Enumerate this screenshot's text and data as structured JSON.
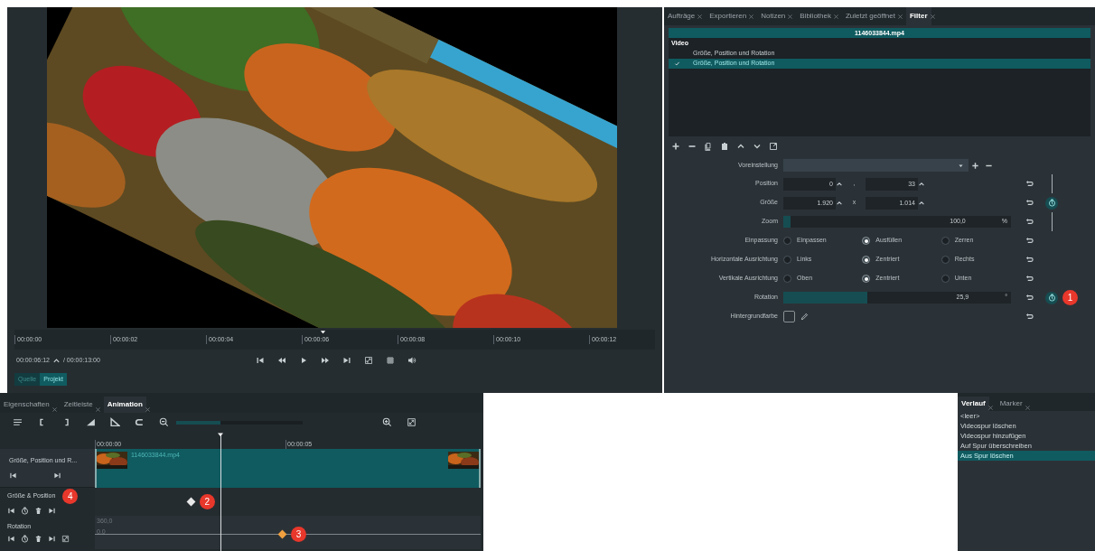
{
  "player": {
    "ruler": [
      "00:00:00",
      "00:00:02",
      "00:00:04",
      "00:00:06",
      "00:00:08",
      "00:00:10",
      "00:00:12"
    ],
    "playhead": {
      "level": 0.475
    },
    "timecode": "00:00:06:12",
    "duration": "/ 00:00:13:00",
    "tabs": [
      {
        "label": "Quelle",
        "selected": false
      },
      {
        "label": "Projekt",
        "selected": true
      }
    ]
  },
  "filter_panel": {
    "tabs": [
      {
        "label": "Aufträge",
        "selected": false
      },
      {
        "label": "Exportieren",
        "selected": false
      },
      {
        "label": "Notizen",
        "selected": false
      },
      {
        "label": "Bibliothek",
        "selected": false
      },
      {
        "label": "Zuletzt geöffnet",
        "selected": false
      },
      {
        "label": "Filter",
        "selected": true
      }
    ],
    "clip": "1146033844.mp4",
    "group": "Video",
    "filters": [
      {
        "label": "Größe, Position und Rotation",
        "checked": false,
        "selected": false
      },
      {
        "label": "Größe, Position und Rotation",
        "checked": true,
        "selected": true
      }
    ],
    "preset": {
      "label": "Voreinstellung"
    },
    "params": [
      {
        "kind": "pair",
        "label": "Position",
        "values": [
          "0",
          "33"
        ],
        "separator": ",",
        "keyframes_linked": true
      },
      {
        "kind": "pair",
        "label": "Größe",
        "values": [
          "1.920",
          "1.014"
        ],
        "separator": "x",
        "keyframes": true
      },
      {
        "kind": "slider",
        "label": "Zoom",
        "level": 0.03,
        "reading": "100,0",
        "unit": "%",
        "keyframes_linked": true
      },
      {
        "kind": "radio",
        "label": "Einpassung",
        "options": [
          {
            "label": "Einpassen",
            "selected": false
          },
          {
            "label": "Ausfüllen",
            "selected": true
          },
          {
            "label": "Zerren",
            "selected": false
          }
        ]
      },
      {
        "kind": "radio",
        "label": "Horizontale Ausrichtung",
        "options": [
          {
            "label": "Links",
            "selected": false
          },
          {
            "label": "Zentriert",
            "selected": true
          },
          {
            "label": "Rechts",
            "selected": false
          }
        ]
      },
      {
        "kind": "radio",
        "label": "Vertikale Ausrichtung",
        "options": [
          {
            "label": "Oben",
            "selected": false
          },
          {
            "label": "Zentriert",
            "selected": true
          },
          {
            "label": "Unten",
            "selected": false
          }
        ]
      },
      {
        "kind": "slider",
        "label": "Rotation",
        "level": 0.37,
        "reading": "25,9",
        "unit": "°",
        "keyframes": true,
        "badge": "1"
      },
      {
        "kind": "color",
        "label": "Hintergrundfarbe"
      }
    ]
  },
  "animation_panel": {
    "tabs": [
      {
        "label": "Eigenschaften",
        "selected": false
      },
      {
        "label": "Zeitleiste",
        "selected": false
      },
      {
        "label": "Animation",
        "selected": true
      }
    ],
    "zoom": {
      "level": 0.35
    },
    "ruler": [
      "00:00:00",
      "00:00:05"
    ],
    "playhead": {
      "level": 0.325
    },
    "clip_track": {
      "label": "Größe, Position und R...",
      "clip": "1146033844.mp4"
    },
    "tracks": [
      {
        "kind": "params",
        "label": "Größe & Position",
        "badge": "4",
        "keyframe": {
          "level": 0.25,
          "color": "#e8e8e8",
          "badge": "2"
        }
      },
      {
        "kind": "curve",
        "label": "Rotation",
        "max": "360,0",
        "min": "0,0",
        "keyframe": {
          "level": 0.487,
          "color": "#f0a040",
          "badge": "3"
        }
      }
    ]
  },
  "history_panel": {
    "tabs": [
      {
        "label": "Verlauf",
        "selected": true
      },
      {
        "label": "Marker",
        "selected": false
      }
    ],
    "items": [
      {
        "label": "<leer>",
        "selected": false
      },
      {
        "label": "Videospur löschen",
        "selected": false
      },
      {
        "label": "Videospur hinzufügen",
        "selected": false
      },
      {
        "label": "Auf Spur überschreiben",
        "selected": false
      },
      {
        "label": "Aus Spur löschen",
        "selected": true
      }
    ]
  }
}
